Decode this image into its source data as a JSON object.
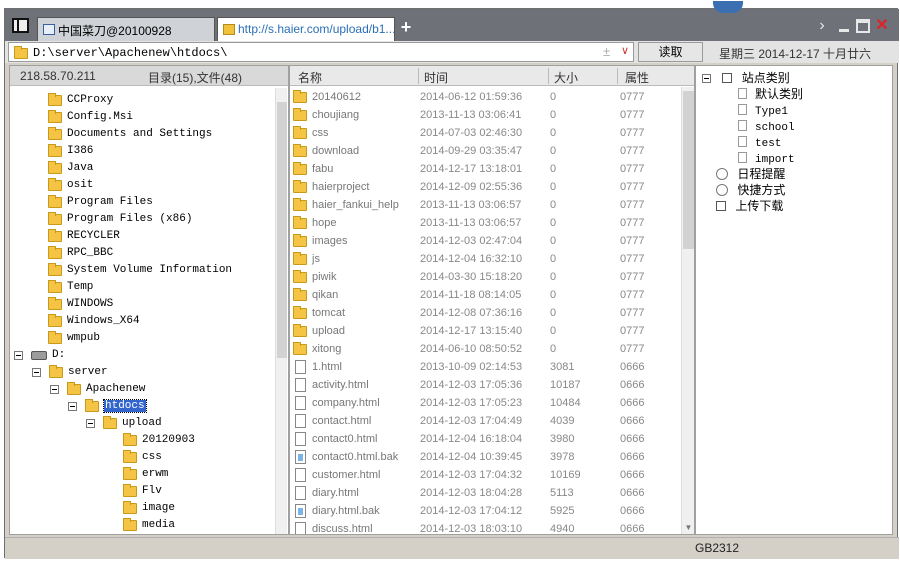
{
  "tabs": [
    {
      "label": "中国菜刀@20100928"
    },
    {
      "label": "http://s.haier.com/upload/b1..."
    }
  ],
  "new_tab_label": "+",
  "address": {
    "value": "D:\\server\\Apachenew\\htdocs\\",
    "read_button": "读取"
  },
  "datetime": "星期三 2014-12-17 十月廿六",
  "left_panel": {
    "ip": "218.58.70.211",
    "summary": "目录(15),文件(48)",
    "c_folders": [
      "CCProxy",
      "Config.Msi",
      "Documents and Settings",
      "I386",
      "Java",
      "osit",
      "Program Files",
      "Program Files (x86)",
      "RECYCLER",
      "RPC_BBC",
      "System Volume Information",
      "Temp",
      "WINDOWS",
      "Windows_X64",
      "wmpub"
    ],
    "drive_label": "D:",
    "server_label": "server",
    "apachenew_label": "Apachenew",
    "htdocs_label": "htdocs",
    "upload_label": "upload",
    "upload_children": [
      "20120903",
      "css",
      "erwm",
      "Flv",
      "image",
      "media"
    ]
  },
  "columns": {
    "name": "名称",
    "time": "时间",
    "size": "大小",
    "attr": "属性"
  },
  "files": [
    {
      "name": "20140612",
      "time": "2014-06-12 01:59:36",
      "size": "0",
      "attr": "0777",
      "type": "folder"
    },
    {
      "name": "choujiang",
      "time": "2013-11-13 03:06:41",
      "size": "0",
      "attr": "0777",
      "type": "folder"
    },
    {
      "name": "css",
      "time": "2014-07-03 02:46:30",
      "size": "0",
      "attr": "0777",
      "type": "folder"
    },
    {
      "name": "download",
      "time": "2014-09-29 03:35:47",
      "size": "0",
      "attr": "0777",
      "type": "folder"
    },
    {
      "name": "fabu",
      "time": "2014-12-17 13:18:01",
      "size": "0",
      "attr": "0777",
      "type": "folder"
    },
    {
      "name": "haierproject",
      "time": "2014-12-09 02:55:36",
      "size": "0",
      "attr": "0777",
      "type": "folder"
    },
    {
      "name": "haier_fankui_help",
      "time": "2013-11-13 03:06:57",
      "size": "0",
      "attr": "0777",
      "type": "folder"
    },
    {
      "name": "hope",
      "time": "2013-11-13 03:06:57",
      "size": "0",
      "attr": "0777",
      "type": "folder"
    },
    {
      "name": "images",
      "time": "2014-12-03 02:47:04",
      "size": "0",
      "attr": "0777",
      "type": "folder"
    },
    {
      "name": "js",
      "time": "2014-12-04 16:32:10",
      "size": "0",
      "attr": "0777",
      "type": "folder"
    },
    {
      "name": "piwik",
      "time": "2014-03-30 15:18:20",
      "size": "0",
      "attr": "0777",
      "type": "folder"
    },
    {
      "name": "qikan",
      "time": "2014-11-18 08:14:05",
      "size": "0",
      "attr": "0777",
      "type": "folder"
    },
    {
      "name": "tomcat",
      "time": "2014-12-08 07:36:16",
      "size": "0",
      "attr": "0777",
      "type": "folder"
    },
    {
      "name": "upload",
      "time": "2014-12-17 13:15:40",
      "size": "0",
      "attr": "0777",
      "type": "folder"
    },
    {
      "name": "xitong",
      "time": "2014-06-10 08:50:52",
      "size": "0",
      "attr": "0777",
      "type": "folder"
    },
    {
      "name": "1.html",
      "time": "2013-10-09 02:14:53",
      "size": "3081",
      "attr": "0666",
      "type": "file"
    },
    {
      "name": "activity.html",
      "time": "2014-12-03 17:05:36",
      "size": "10187",
      "attr": "0666",
      "type": "file"
    },
    {
      "name": "company.html",
      "time": "2014-12-03 17:05:23",
      "size": "10484",
      "attr": "0666",
      "type": "file"
    },
    {
      "name": "contact.html",
      "time": "2014-12-03 17:04:49",
      "size": "4039",
      "attr": "0666",
      "type": "file"
    },
    {
      "name": "contact0.html",
      "time": "2014-12-04 16:18:04",
      "size": "3980",
      "attr": "0666",
      "type": "file"
    },
    {
      "name": "contact0.html.bak",
      "time": "2014-12-04 10:39:45",
      "size": "3978",
      "attr": "0666",
      "type": "bak"
    },
    {
      "name": "customer.html",
      "time": "2014-12-03 17:04:32",
      "size": "10169",
      "attr": "0666",
      "type": "file"
    },
    {
      "name": "diary.html",
      "time": "2014-12-03 18:04:28",
      "size": "5113",
      "attr": "0666",
      "type": "file"
    },
    {
      "name": "diary.html.bak",
      "time": "2014-12-03 17:04:12",
      "size": "5925",
      "attr": "0666",
      "type": "bak"
    },
    {
      "name": "discuss.html",
      "time": "2014-12-03 18:03:10",
      "size": "4940",
      "attr": "0666",
      "type": "file"
    }
  ],
  "right_panel": {
    "site_category": "站点类别",
    "categories": [
      "默认类别",
      "Type1",
      "school",
      "test",
      "import"
    ],
    "schedule": "日程提醒",
    "shortcuts": "快捷方式",
    "transfer": "上传下载"
  },
  "status": {
    "encoding": "GB2312"
  },
  "colors": {
    "accent": "#3366cc",
    "titlebar": "#6e7278",
    "folder": "#f6c445",
    "close": "#e0202a"
  }
}
